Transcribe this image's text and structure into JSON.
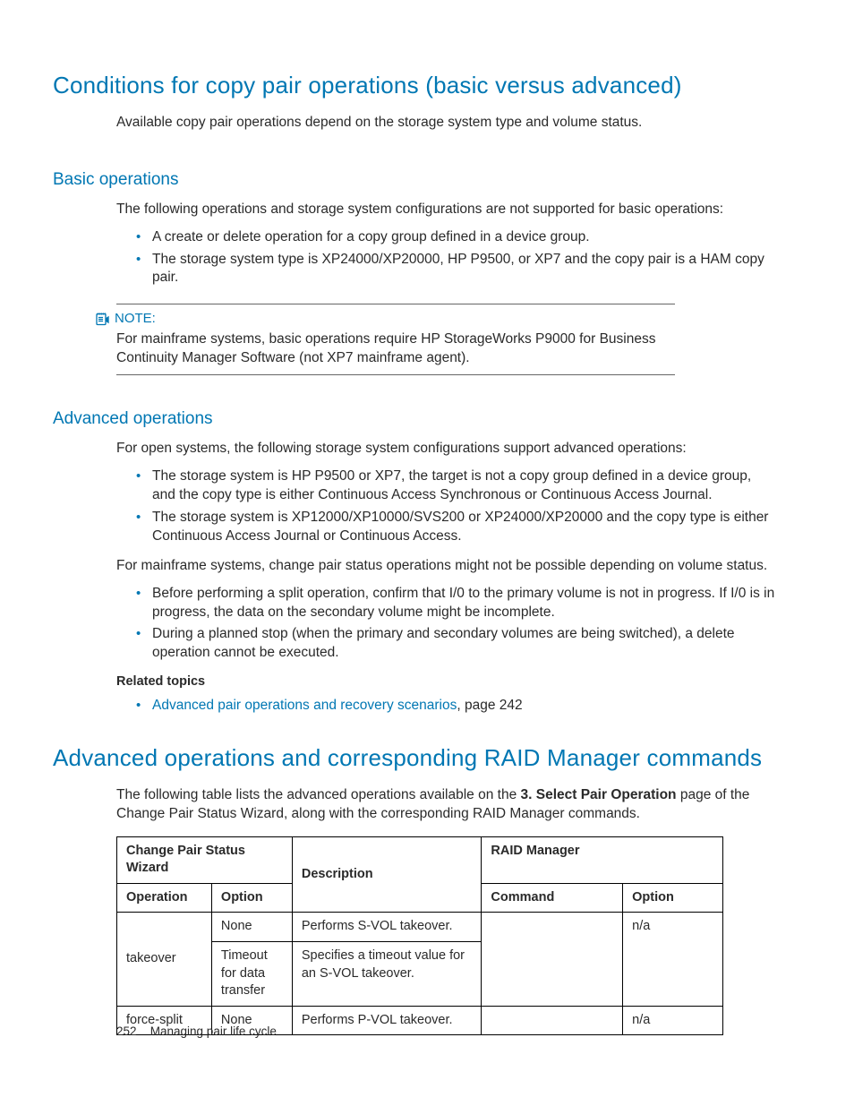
{
  "h1_1": "Conditions for copy pair operations (basic versus advanced)",
  "p1": "Available copy pair operations depend on the storage system type and volume status.",
  "h2_basic": "Basic operations",
  "p_basic_intro": "The following operations and storage system configurations are not supported for basic operations:",
  "basic_bullets": [
    "A create or delete operation for a copy group defined in a device group.",
    "The storage system type is XP24000/XP20000, HP P9500, or XP7 and the copy pair is a HAM copy pair."
  ],
  "note_label": "NOTE:",
  "note_body": "For mainframe systems, basic operations require HP StorageWorks P9000 for Business Continuity Manager Software (not XP7 mainframe agent).",
  "h2_advanced": "Advanced operations",
  "p_adv_intro": "For open systems, the following storage system configurations support advanced operations:",
  "adv_bullets_a": [
    "The storage system is HP P9500 or XP7, the target is not a copy group defined in a device group, and the copy type is either Continuous Access Synchronous or Continuous Access Journal.",
    "The storage system is XP12000/XP10000/SVS200 or XP24000/XP20000 and the copy type is either Continuous Access Journal or Continuous Access."
  ],
  "p_adv_mf": "For mainframe systems, change pair status operations might not be possible depending on volume status.",
  "adv_bullets_b": [
    "Before performing a split operation, confirm that I/0 to the primary volume is not in progress. If I/0 is in progress, the data on the secondary volume might be incomplete.",
    "During a planned stop (when the primary and secondary volumes are being switched), a delete operation cannot be executed."
  ],
  "related_label": "Related topics",
  "related_link": "Advanced pair operations and recovery scenarios",
  "related_suffix": ", page 242",
  "h1_2": "Advanced operations and corresponding RAID Manager commands",
  "p_cmds_intro_a": "The following table lists the advanced operations available on the ",
  "p_cmds_intro_bold": "3. Select Pair Operation",
  "p_cmds_intro_b": " page of the Change Pair Status Wizard, along with the corresponding RAID Manager commands.",
  "table": {
    "head_group1": "Change Pair Status Wizard",
    "head_desc": "Description",
    "head_group2": "RAID Manager",
    "head_op": "Operation",
    "head_opt": "Option",
    "head_cmd": "Command",
    "head_opt2": "Option",
    "rows": [
      {
        "op": "takeover",
        "opt": "None",
        "desc": "Performs S-VOL takeover.",
        "cmd": "",
        "ropt": "n/a"
      },
      {
        "op": "",
        "opt": "Timeout for data trans­fer",
        "desc": "Specifies a timeout value for an S-VOL takeover.",
        "cmd": "",
        "ropt": ""
      },
      {
        "op": "force-split",
        "opt": "None",
        "desc": "Performs P-VOL takeover.",
        "cmd": "",
        "ropt": "n/a"
      }
    ]
  },
  "footer_page": "252",
  "footer_title": "Managing pair life cycle"
}
